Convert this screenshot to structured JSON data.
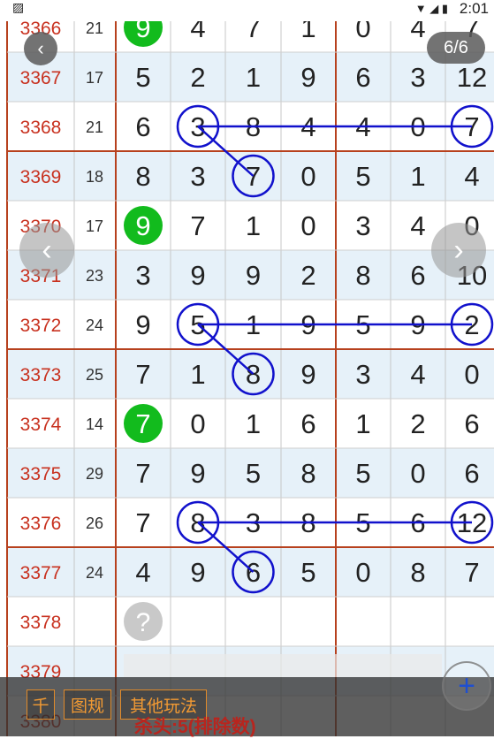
{
  "status_bar": {
    "time": "2:01"
  },
  "nav": {
    "back_icon": "‹",
    "page_counter": "6/6",
    "prev_icon": "‹",
    "next_icon": "›"
  },
  "table": {
    "rows": [
      {
        "period": "3366",
        "sum": "21",
        "digits": [
          "9",
          "4",
          "7",
          "1",
          "0",
          "4",
          "7"
        ],
        "green": 0
      },
      {
        "period": "3367",
        "sum": "17",
        "digits": [
          "5",
          "2",
          "1",
          "9",
          "6",
          "3",
          "12"
        ]
      },
      {
        "period": "3368",
        "sum": "21",
        "digits": [
          "6",
          "3",
          "8",
          "4",
          "4",
          "0",
          "7"
        ],
        "circles": [
          1,
          6
        ],
        "line_to": 2
      },
      {
        "period": "3369",
        "sum": "18",
        "digits": [
          "8",
          "3",
          "7",
          "0",
          "5",
          "1",
          "4"
        ],
        "circles": [
          2
        ]
      },
      {
        "period": "3370",
        "sum": "17",
        "digits": [
          "9",
          "7",
          "1",
          "0",
          "3",
          "4",
          "0"
        ],
        "green": 0
      },
      {
        "period": "3371",
        "sum": "23",
        "digits": [
          "3",
          "9",
          "9",
          "2",
          "8",
          "6",
          "10"
        ]
      },
      {
        "period": "3372",
        "sum": "24",
        "digits": [
          "9",
          "5",
          "1",
          "9",
          "5",
          "9",
          "2"
        ],
        "circles": [
          1,
          6
        ],
        "line_to": 2
      },
      {
        "period": "3373",
        "sum": "25",
        "digits": [
          "7",
          "1",
          "8",
          "9",
          "3",
          "4",
          "0"
        ],
        "circles": [
          2
        ]
      },
      {
        "period": "3374",
        "sum": "14",
        "digits": [
          "7",
          "0",
          "1",
          "6",
          "1",
          "2",
          "6"
        ],
        "green": 0
      },
      {
        "period": "3375",
        "sum": "29",
        "digits": [
          "7",
          "9",
          "5",
          "8",
          "5",
          "0",
          "6"
        ]
      },
      {
        "period": "3376",
        "sum": "26",
        "digits": [
          "7",
          "8",
          "3",
          "8",
          "5",
          "6",
          "12"
        ],
        "circles": [
          1,
          6
        ],
        "line_to": 2
      },
      {
        "period": "3377",
        "sum": "24",
        "digits": [
          "4",
          "9",
          "6",
          "5",
          "0",
          "8",
          "7"
        ],
        "circles": [
          2
        ]
      },
      {
        "period": "3378",
        "sum": "",
        "digits": [
          "?",
          "",
          "",
          "",
          "",
          "",
          ""
        ],
        "question": 0
      },
      {
        "period": "3379",
        "sum": "",
        "digits": [
          "",
          "",
          "",
          "",
          "",
          "",
          ""
        ]
      },
      {
        "period": "3380",
        "sum": "",
        "digits": [
          "",
          "",
          "",
          "",
          "",
          "",
          ""
        ]
      }
    ]
  },
  "bottom_bar": {
    "tabs": [
      "千",
      "图规",
      "其他玩法"
    ],
    "note": "杀头:5(排除数)"
  },
  "colors": {
    "period_red": "#c8311f",
    "accent_line": "#1111cc",
    "green_ball": "#12bb1d",
    "row_blue": "#e6f1f9",
    "separator_red": "#b7411e"
  }
}
